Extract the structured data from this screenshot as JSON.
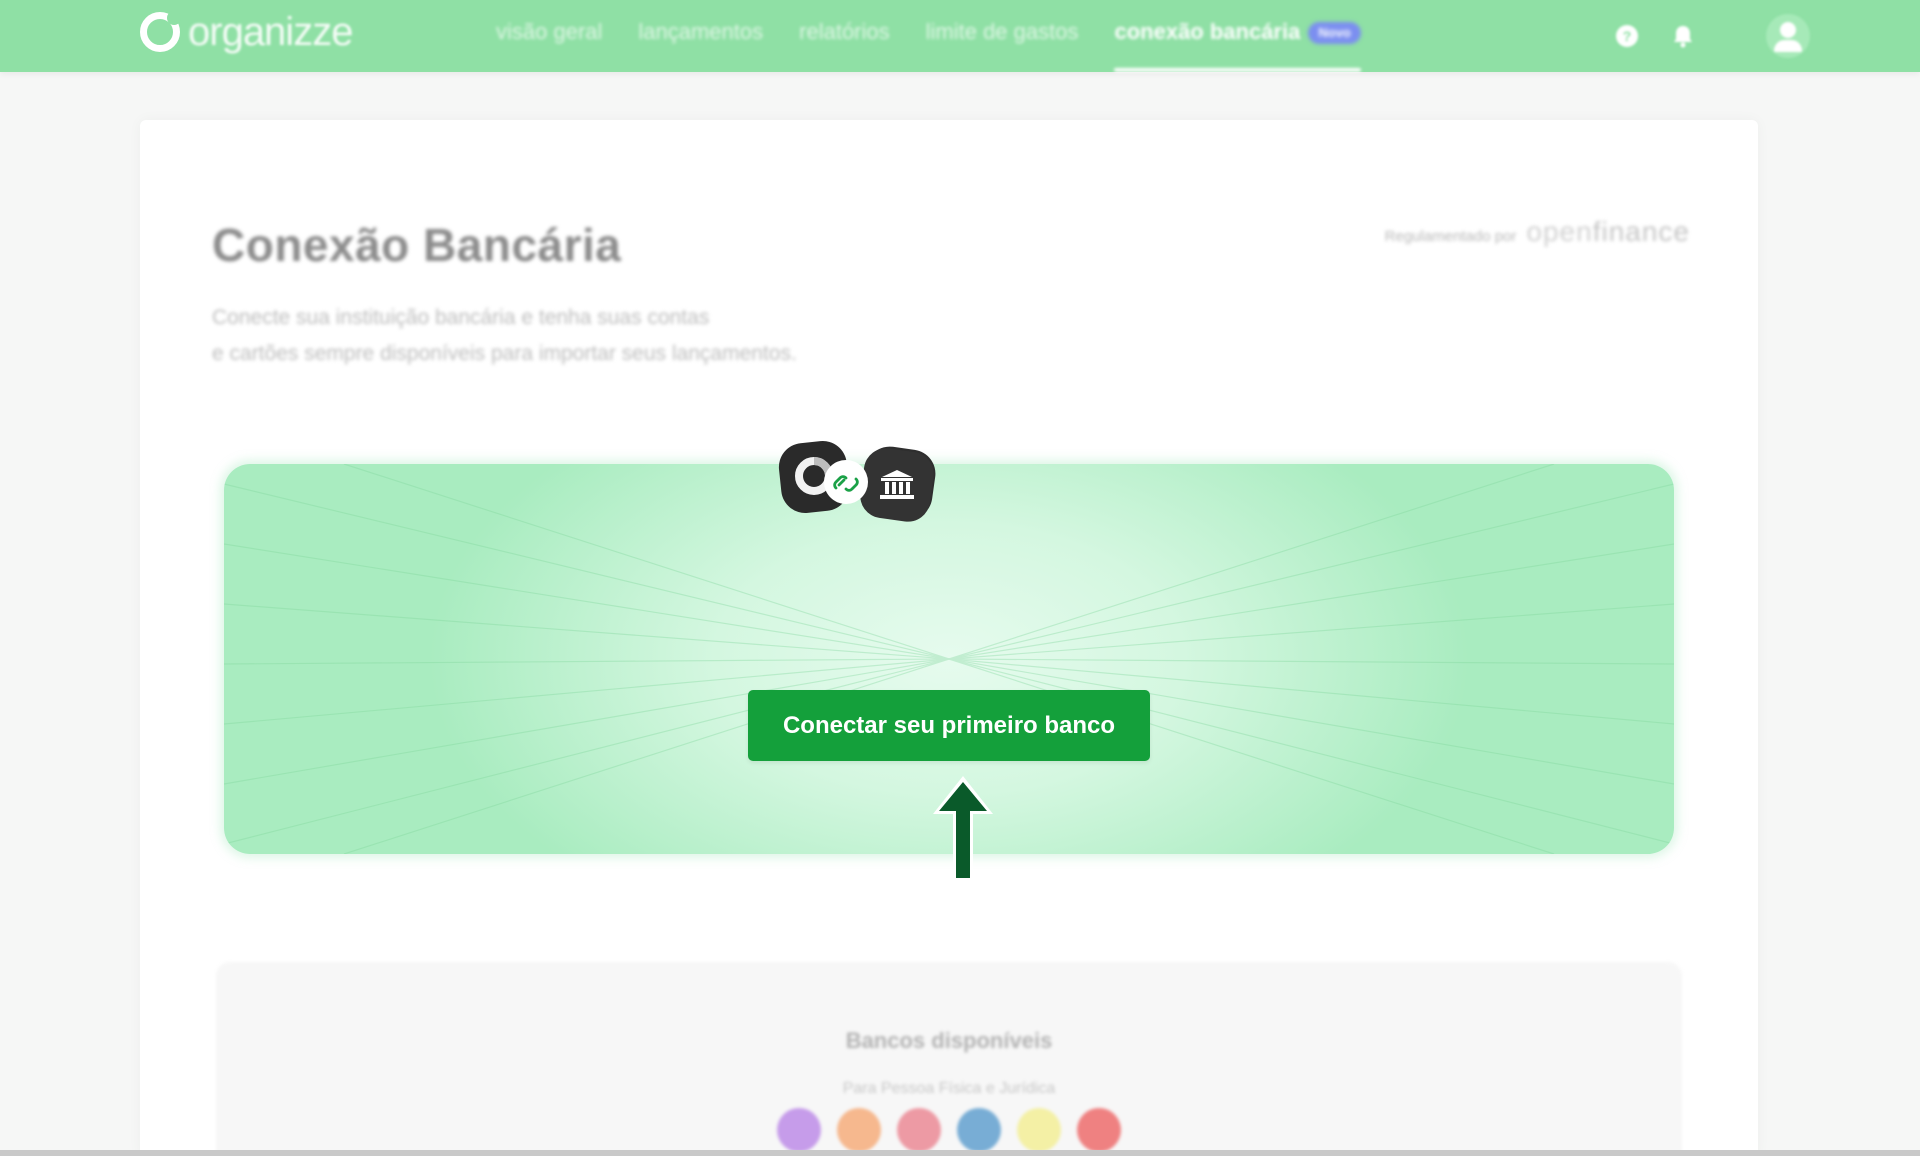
{
  "brand": {
    "name": "organizze"
  },
  "nav": {
    "items": [
      {
        "label": "visão geral"
      },
      {
        "label": "lançamentos"
      },
      {
        "label": "relatórios"
      },
      {
        "label": "limite de gastos"
      },
      {
        "label": "conexão bancária",
        "active": true,
        "badge": "Novo"
      }
    ]
  },
  "topbar_icons": [
    "help-icon",
    "bell-icon",
    "user-avatar"
  ],
  "page": {
    "title": "Conexão Bancária",
    "description_line1": "Conecte sua instituição bancária e tenha suas contas",
    "description_line2": "e cartões sempre disponíveis para importar seus lançamentos.",
    "regulated_label": "Regulamentado por",
    "regulated_logo_a": "open",
    "regulated_logo_b": "finance"
  },
  "hero": {
    "icons": [
      "organizze-app-icon",
      "link-icon",
      "bank-icon"
    ],
    "button_label": "Conectar seu primeiro banco"
  },
  "banks": {
    "title": "Bancos disponíveis",
    "subtitle": "Para Pessoa Física e Jurídica",
    "logo_colors": [
      "#b57ee6",
      "#f6a36b",
      "#e97b88",
      "#4d94c9",
      "#f3ee8a",
      "#ec5a5a"
    ]
  },
  "colors": {
    "topbar": "#8fe0a5",
    "primary_button": "#14a03b",
    "arrow": "#0a5a2a",
    "badge": "#7b8ef0"
  }
}
